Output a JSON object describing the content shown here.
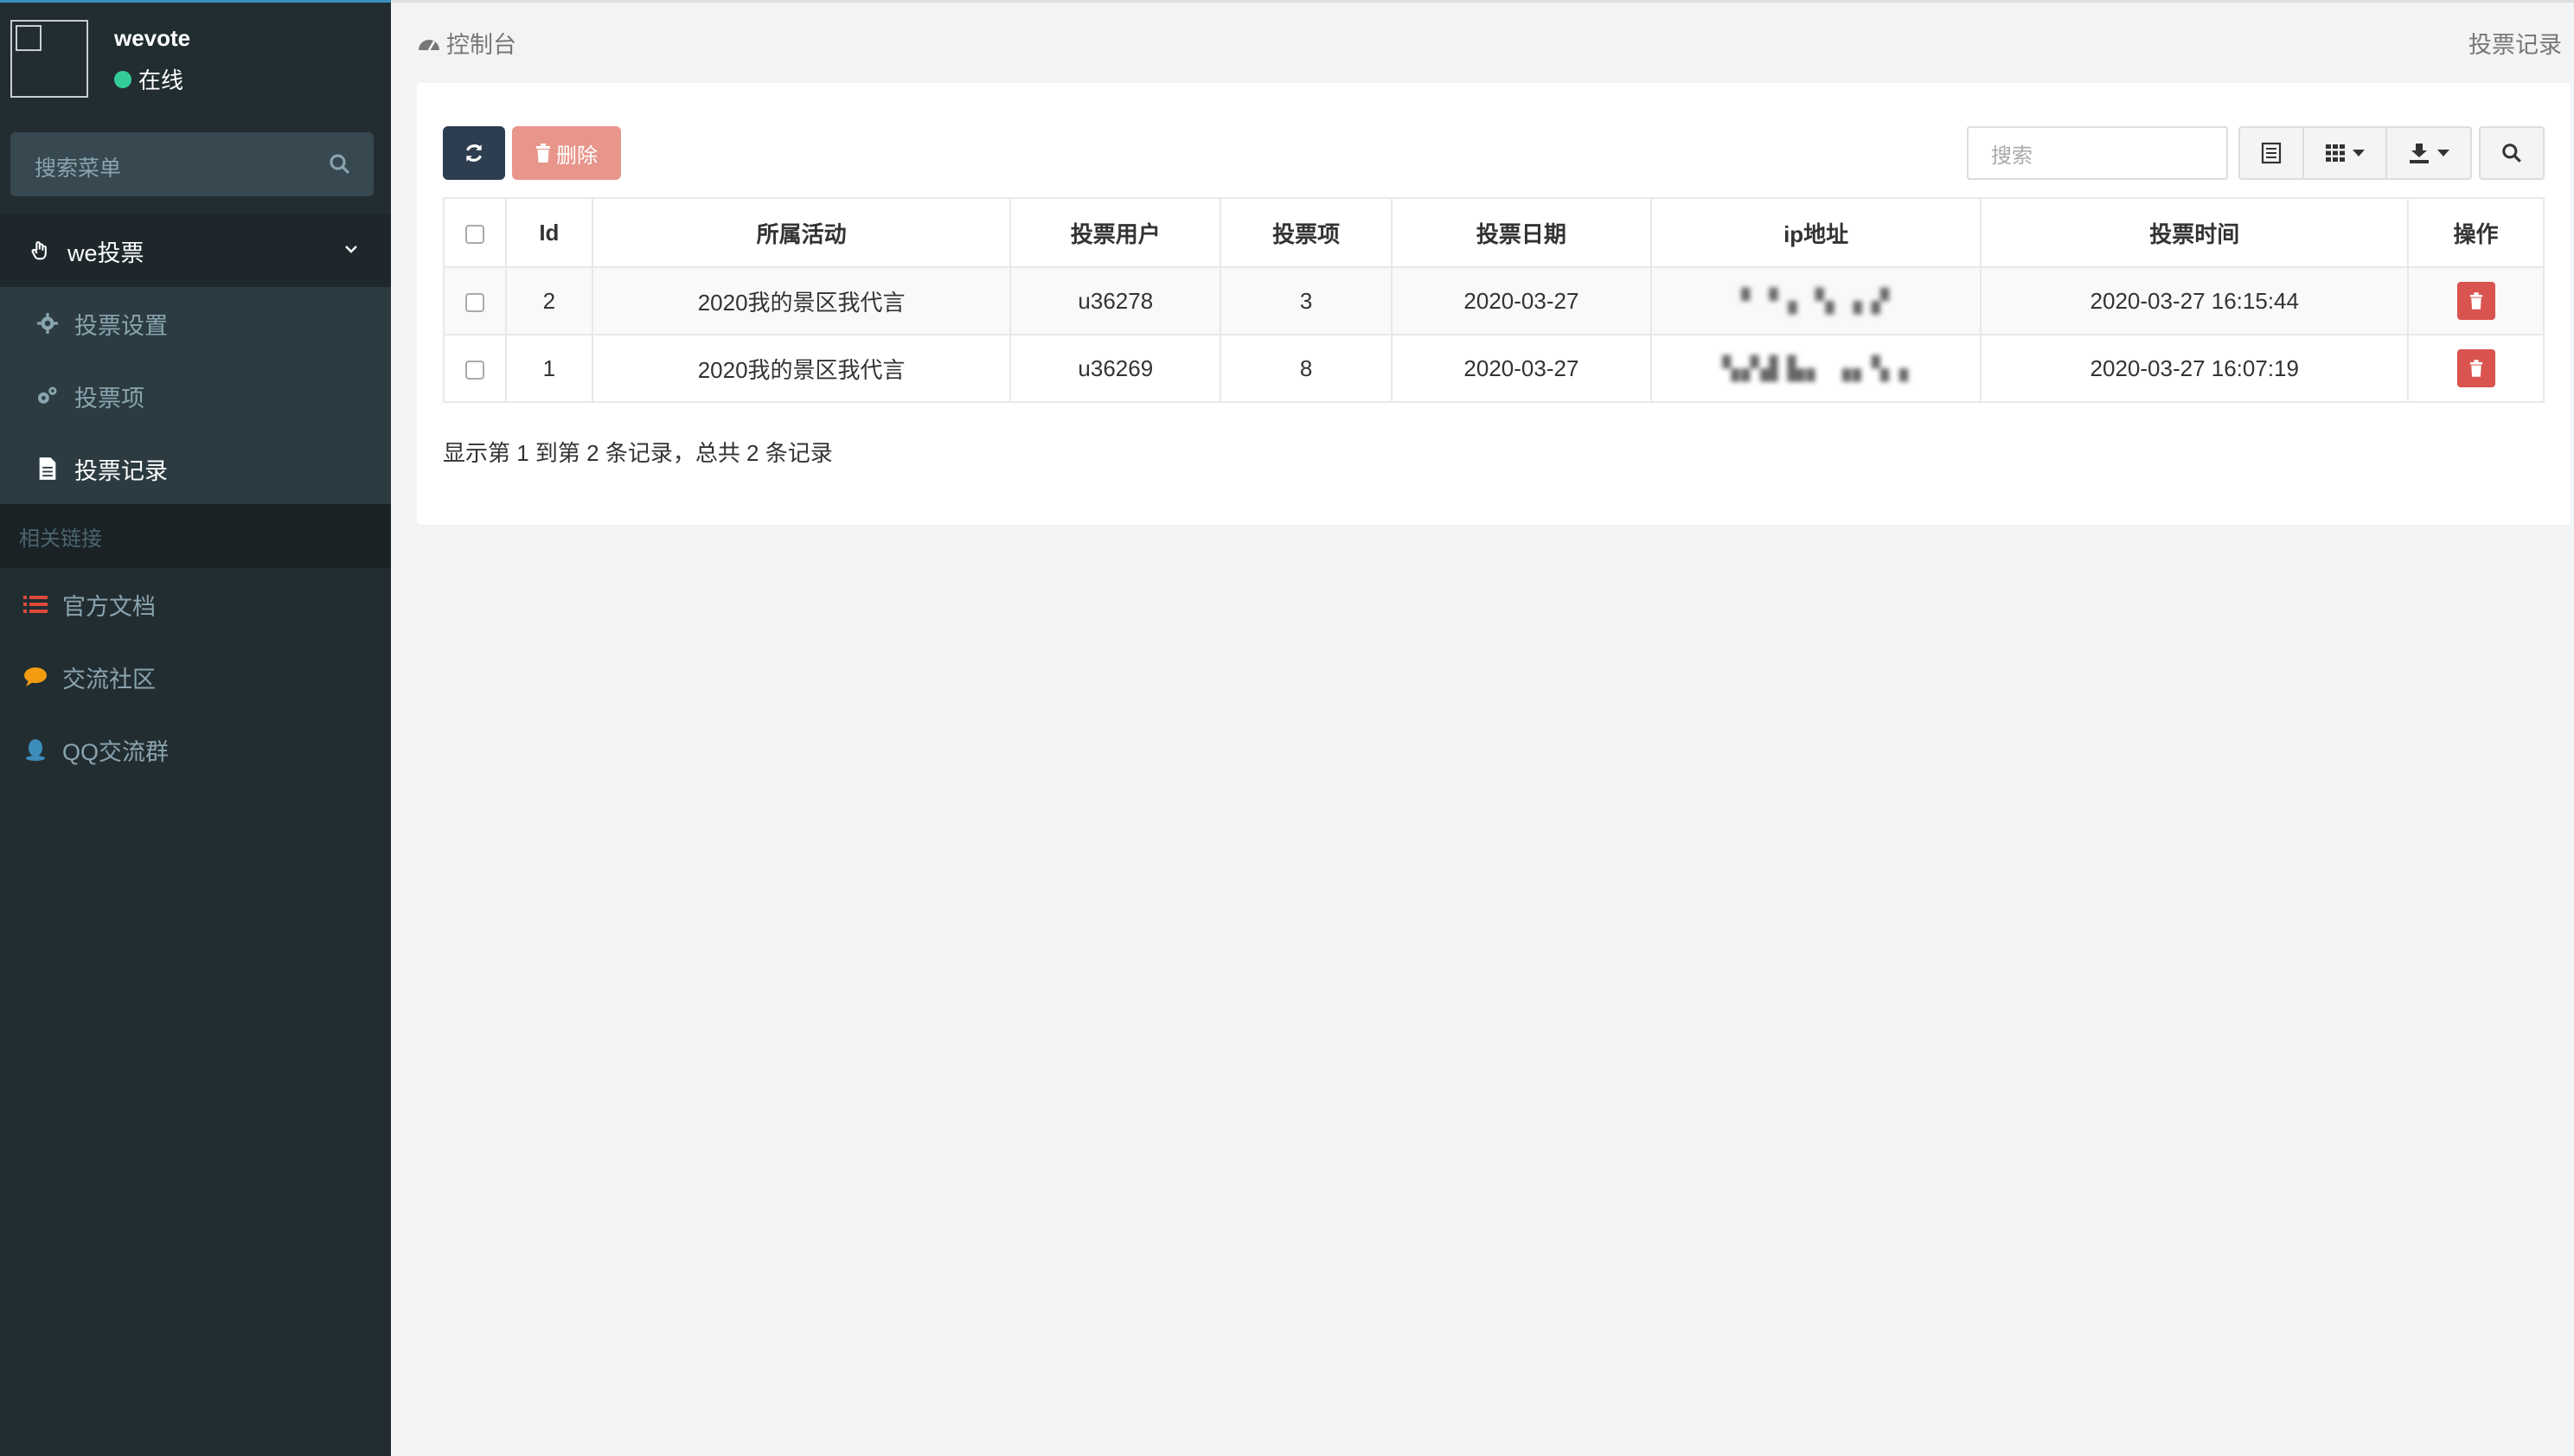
{
  "sidebar": {
    "user": {
      "name": "wevote",
      "status": "在线",
      "status_color": "#33cc99"
    },
    "search_placeholder": "搜索菜单",
    "menu_group": {
      "label": "we投票"
    },
    "items": [
      {
        "label": "投票设置",
        "icon": "gear-icon"
      },
      {
        "label": "投票项",
        "icon": "gears-icon"
      },
      {
        "label": "投票记录",
        "icon": "file-icon",
        "active": true
      }
    ],
    "section_header": "相关链接",
    "links": [
      {
        "label": "官方文档",
        "icon": "list-icon",
        "color": "#dd4b39"
      },
      {
        "label": "交流社区",
        "icon": "comment-icon",
        "color": "#f39c12"
      },
      {
        "label": "QQ交流群",
        "icon": "qq-icon",
        "color": "#3c8dbc"
      }
    ]
  },
  "topbar": {
    "breadcrumb": "控制台",
    "page_name": "投票记录"
  },
  "toolbar": {
    "delete_label": "删除",
    "search_placeholder": "搜索"
  },
  "table": {
    "columns": [
      "Id",
      "所属活动",
      "投票用户",
      "投票项",
      "投票日期",
      "ip地址",
      "投票时间",
      "操作"
    ],
    "rows": [
      {
        "id": "2",
        "activity": "2020我的景区我代言",
        "user": "u36278",
        "item": "3",
        "date": "2020-03-27",
        "ip": "▘▝▗ ▝▖▗ ▞",
        "time": "2020-03-27 16:15:44"
      },
      {
        "id": "1",
        "activity": "2020我的景区我代言",
        "user": "u36269",
        "item": "8",
        "date": "2020-03-27",
        "ip": "▚▞▟ ▙▖ ▗▖▚▗",
        "time": "2020-03-27 16:07:19"
      }
    ]
  },
  "pager": {
    "summary": "显示第 1 到第 2 条记录，总共 2 条记录"
  },
  "colors": {
    "sidebar_bg": "#222d32",
    "primary_dark": "#2c3e50",
    "danger": "#d9534f",
    "danger_light": "#e8958b"
  }
}
